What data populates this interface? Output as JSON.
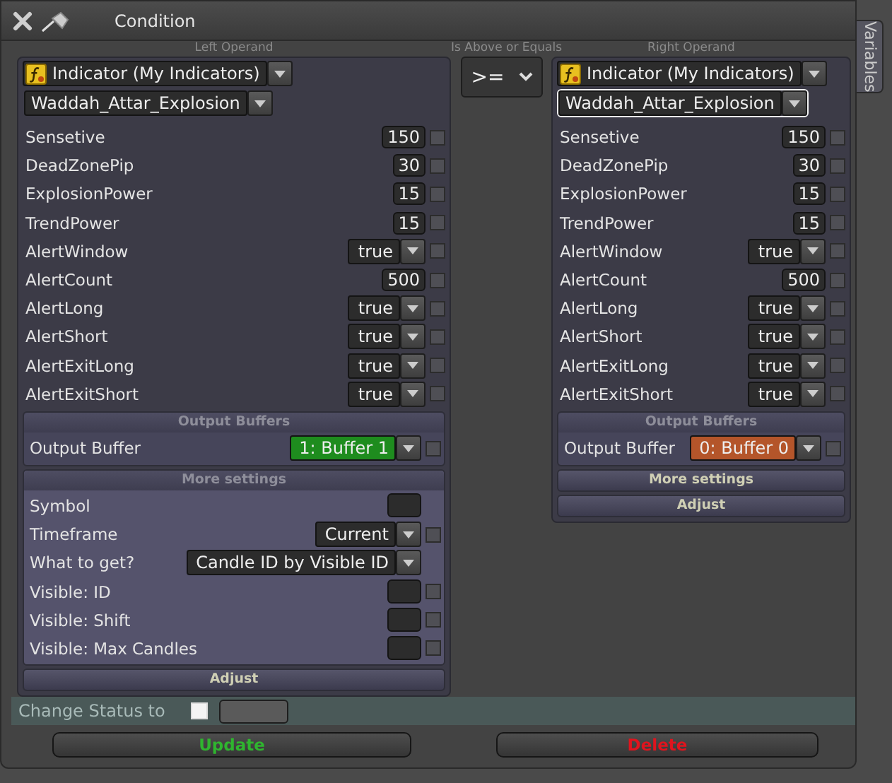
{
  "window": {
    "title": "Condition"
  },
  "side_tab": {
    "label": "Variables"
  },
  "left_operand": {
    "caption": "Left Operand",
    "source": {
      "value": "Indicator (My Indicators)"
    },
    "indicator": {
      "value": "Waddah_Attar_Explosion",
      "focused": false
    },
    "params": [
      {
        "label": "Sensetive",
        "kind": "number",
        "value": "150",
        "checked": false
      },
      {
        "label": "DeadZonePip",
        "kind": "number",
        "value": "30",
        "checked": false
      },
      {
        "label": "ExplosionPower",
        "kind": "number",
        "value": "15",
        "checked": false
      },
      {
        "label": "TrendPower",
        "kind": "number",
        "value": "15",
        "checked": false
      },
      {
        "label": "AlertWindow",
        "kind": "select",
        "value": "true",
        "checked": false
      },
      {
        "label": "AlertCount",
        "kind": "number",
        "value": "500",
        "checked": false
      },
      {
        "label": "AlertLong",
        "kind": "select",
        "value": "true",
        "checked": false
      },
      {
        "label": "AlertShort",
        "kind": "select",
        "value": "true",
        "checked": false
      },
      {
        "label": "AlertExitLong",
        "kind": "select",
        "value": "true",
        "checked": false
      },
      {
        "label": "AlertExitShort",
        "kind": "select",
        "value": "true",
        "checked": false
      }
    ],
    "output_buffers": {
      "header": "Output Buffers",
      "rows": [
        {
          "label": "Output Buffer",
          "value": "1: Buffer 1",
          "color": "#1e8c1e",
          "checked": false
        }
      ]
    },
    "more_settings": {
      "header": "More settings",
      "expanded": true,
      "rows": [
        {
          "label": "Symbol",
          "kind": "blank"
        },
        {
          "label": "Timeframe",
          "kind": "select",
          "value": "Current",
          "checked": false
        },
        {
          "label": "What to get?",
          "kind": "select",
          "value": "Candle ID by Visible ID"
        },
        {
          "label": "Visible: ID",
          "kind": "blank",
          "checked": false
        },
        {
          "label": "Visible: Shift",
          "kind": "blank",
          "checked": false
        },
        {
          "label": "Visible: Max Candles",
          "kind": "blank",
          "checked": false
        }
      ]
    },
    "adjust": "Adjust"
  },
  "comparator": {
    "caption": "Is Above or Equals",
    "value": ">="
  },
  "right_operand": {
    "caption": "Right Operand",
    "source": {
      "value": "Indicator (My Indicators)"
    },
    "indicator": {
      "value": "Waddah_Attar_Explosion",
      "focused": true
    },
    "params": [
      {
        "label": "Sensetive",
        "kind": "number",
        "value": "150",
        "checked": false
      },
      {
        "label": "DeadZonePip",
        "kind": "number",
        "value": "30",
        "checked": false
      },
      {
        "label": "ExplosionPower",
        "kind": "number",
        "value": "15",
        "checked": false
      },
      {
        "label": "TrendPower",
        "kind": "number",
        "value": "15",
        "checked": false
      },
      {
        "label": "AlertWindow",
        "kind": "select",
        "value": "true",
        "checked": false
      },
      {
        "label": "AlertCount",
        "kind": "number",
        "value": "500",
        "checked": false
      },
      {
        "label": "AlertLong",
        "kind": "select",
        "value": "true",
        "checked": false
      },
      {
        "label": "AlertShort",
        "kind": "select",
        "value": "true",
        "checked": false
      },
      {
        "label": "AlertExitLong",
        "kind": "select",
        "value": "true",
        "checked": false
      },
      {
        "label": "AlertExitShort",
        "kind": "select",
        "value": "true",
        "checked": false
      }
    ],
    "output_buffers": {
      "header": "Output Buffers",
      "rows": [
        {
          "label": "Output Buffer",
          "value": "0: Buffer 0",
          "color": "#b4552a",
          "checked": false
        }
      ]
    },
    "more_settings": {
      "header": "More settings",
      "expanded": false
    },
    "adjust": "Adjust"
  },
  "status": {
    "label": "Change Status to",
    "checked": false
  },
  "buttons": [
    {
      "label": "Update",
      "kind": "update"
    },
    {
      "label": "Delete",
      "kind": "delete"
    }
  ]
}
